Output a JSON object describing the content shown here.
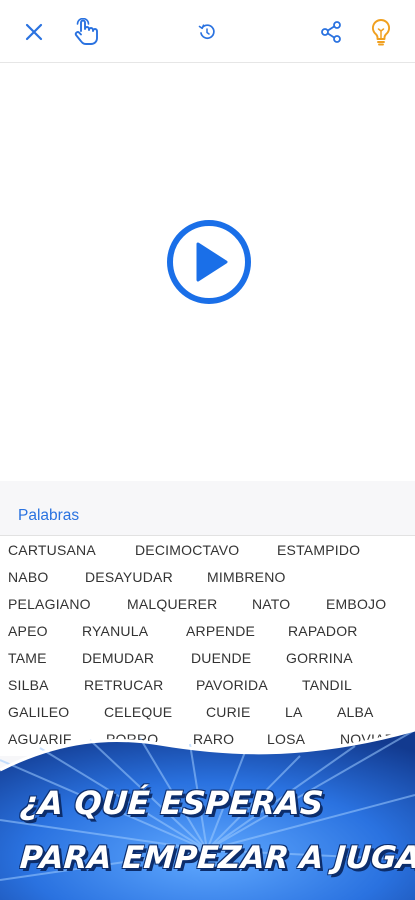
{
  "toolbar": {
    "close_icon": "close-icon",
    "hand_icon": "hand-touch-icon",
    "reset_icon": "timer-reset-icon",
    "share_icon": "share-icon",
    "hint_icon": "lightbulb-icon"
  },
  "colors": {
    "accent": "#2a72e0",
    "hint": "#f0a020",
    "banner_blue": "#1f5fd0"
  },
  "player": {
    "icon": "play-circle-icon"
  },
  "words": {
    "header": "Palabras",
    "rows": [
      [
        "CARTUSANA",
        "DECIMOCTAVO",
        "ESTAMPIDO"
      ],
      [
        "NABO",
        "DESAYUDAR",
        "MIMBRENO"
      ],
      [
        "PELAGIANO",
        "MALQUERER",
        "NATO",
        "EMBOJO"
      ],
      [
        "APEO",
        "RYANULA",
        "ARPENDE",
        "RAPADOR"
      ],
      [
        "TAME",
        "DEMUDAR",
        "DUENDE",
        "GORRINA"
      ],
      [
        "SILBA",
        "RETRUCAR",
        "PAVORIDA",
        "TANDIL"
      ],
      [
        "GALILEO",
        "CELEQUE",
        "CURIE",
        "LA",
        "ALBA"
      ],
      [
        "AGUARIF",
        "PORRO",
        "RARO",
        "LOSA",
        "NOVIAR"
      ]
    ]
  },
  "banner": {
    "line1": "¿A QUÉ ESPERAS",
    "line2": "PARA EMPEZAR A JUGAR?"
  }
}
